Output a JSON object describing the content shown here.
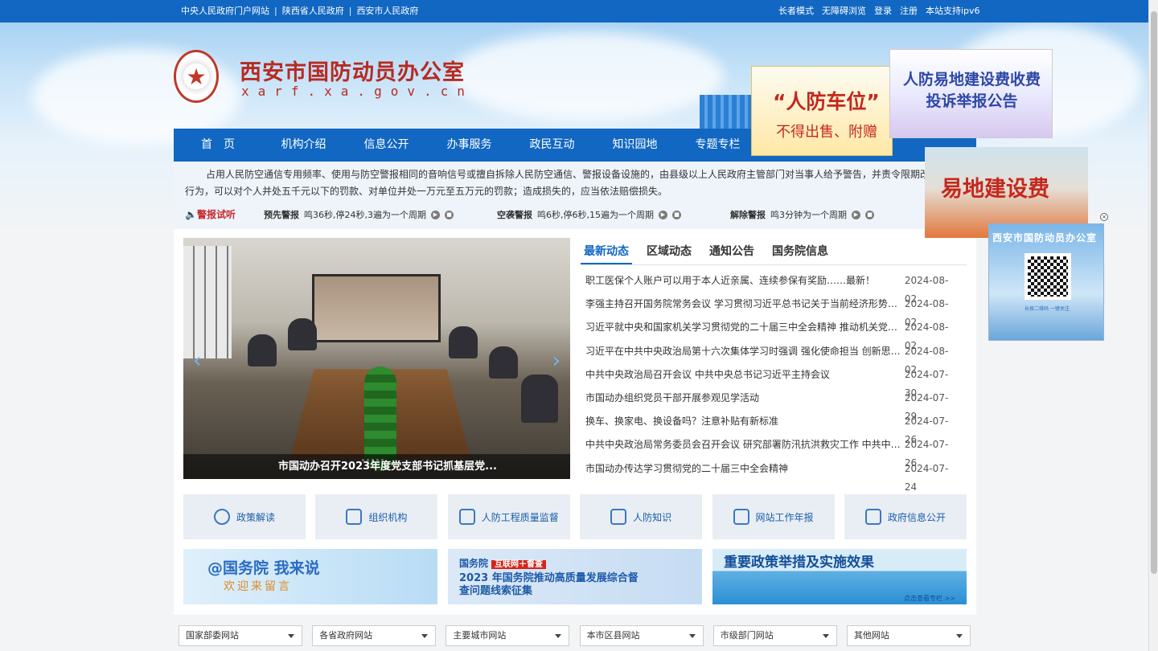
{
  "topbar": {
    "left_links": [
      "中央人民政府门户网站",
      "陕西省人民政府",
      "西安市人民政府"
    ],
    "right_links": [
      "长者模式",
      "无障碍浏览",
      "登录",
      "注册",
      "本站支持ipv6"
    ]
  },
  "header": {
    "title": "西安市国防动员办公室",
    "domain": "xarf.xa.gov.cn"
  },
  "nav": [
    "首　页",
    "机构介绍",
    "信息公开",
    "办事服务",
    "政民互动",
    "知识园地",
    "专题专栏"
  ],
  "notice": {
    "text": "占用人民防空通信专用频率、使用与防空警报相同的音响信号或擅自拆除人民防空通信、警报设备设施的，由县级以上人民政府主管部门对当事人给予警告，并责令限期改正违法行为，可以对个人并处五千元以下的罚款、对单位并处一万元至五万元的罚款；造成损失的，应当依法赔偿损失。",
    "alarm_title": "警报试听",
    "alarms": [
      {
        "name": "预先警报",
        "desc": "鸣36秒,停24秒,3遍为一个周期"
      },
      {
        "name": "空袭警报",
        "desc": "鸣6秒,停6秒,15遍为一个周期"
      },
      {
        "name": "解除警报",
        "desc": "鸣3分钟为一个周期"
      }
    ]
  },
  "slider": {
    "caption": "市国动办召开2023年度党支部书记抓基层党...",
    "prev": "‹",
    "next": "›"
  },
  "tabs": [
    "最新动态",
    "区域动态",
    "通知公告",
    "国务院信息"
  ],
  "news": [
    {
      "title": "职工医保个人账户可以用于本人近亲属、连续参保有奖励……最新！",
      "date": "2024-08-02"
    },
    {
      "title": "李强主持召开国务院常务会议 学习贯彻习近平总书记关于当前经济形势和经济工作的重要讲话",
      "date": "2024-08-02"
    },
    {
      "title": "习近平就中央和国家机关学习贯彻党的二十届三中全会精神 推动机关党建高质量发展",
      "date": "2024-08-02"
    },
    {
      "title": "习近平在中共中央政治局第十六次集体学习时强调 强化使命担当 创新思路举措",
      "date": "2024-08-02"
    },
    {
      "title": "中共中央政治局召开会议 中共中央总书记习近平主持会议",
      "date": "2024-07-30"
    },
    {
      "title": "市国动办组织党员干部开展参观见学活动",
      "date": "2024-07-29"
    },
    {
      "title": "换车、换家电、换设备吗？注意补贴有新标准",
      "date": "2024-07-26"
    },
    {
      "title": "中共中央政治局常务委员会召开会议 研究部署防汛抗洪救灾工作 中共中央总书记习近平主持会议",
      "date": "2024-07-26"
    },
    {
      "title": "市国动办传达学习贯彻党的二十届三中全会精神",
      "date": "2024-07-24"
    }
  ],
  "quick_links": [
    "政策解读",
    "组织机构",
    "人防工程质量监督",
    "人防知识",
    "网站工作年报",
    "政府信息公开"
  ],
  "banners": {
    "b1": {
      "line1": "@国务院 我来说",
      "line2": "欢迎来留言"
    },
    "b2": {
      "brand": "国务院",
      "tag": "互联网＋督查",
      "line": "2023 年国务院推动高质量发展综合督查问题线索征集"
    },
    "b3": {
      "title": "重要政策举措及实施效果",
      "more": "点击查看专栏 >>"
    }
  },
  "footer_links": [
    "国家部委网站",
    "各省政府网站",
    "主要城市网站",
    "本市区县网站",
    "市级部门网站",
    "其他网站"
  ],
  "floats": {
    "f1": {
      "line1": "“人防车位”",
      "line2": "不得出售、附赠"
    },
    "f2": {
      "line1": "人防易地建设费收费",
      "line2": "投诉举报公告"
    },
    "f3": {
      "line1": "易地建设费"
    },
    "f4": {
      "line1": "西安市国防动员办公室",
      "line2": "长按二维码 一键关注"
    },
    "close": "×"
  },
  "colors": {
    "brand_blue": "#1167c2",
    "brand_red": "#b72a22"
  }
}
